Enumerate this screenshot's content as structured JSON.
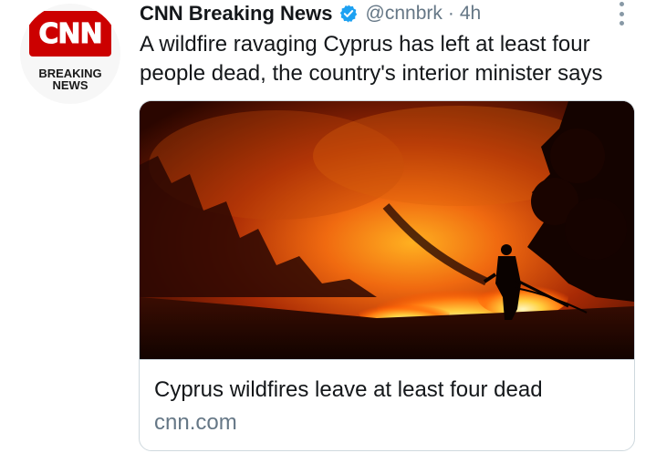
{
  "avatar": {
    "logo_text": "CNN",
    "caption": "BREAKING\nNEWS",
    "brand_color": "#cc0000"
  },
  "header": {
    "display_name": "CNN Breaking News",
    "verified_icon": "verified-badge-icon",
    "handle": "@cnnbrk",
    "separator": "·",
    "time": "4h",
    "more_icon": "more-vertical-icon"
  },
  "tweet": {
    "text": "A wildfire ravaging Cyprus has left at least four people dead, the country's interior minister says"
  },
  "card": {
    "image_description_icon": "wildfire-photo",
    "title": "Cyprus wildfires leave at least four dead",
    "domain": "cnn.com"
  },
  "colors": {
    "text_primary": "#14171a",
    "text_secondary": "#657786",
    "verified_blue": "#1da1f2",
    "border": "#cfd9de"
  }
}
